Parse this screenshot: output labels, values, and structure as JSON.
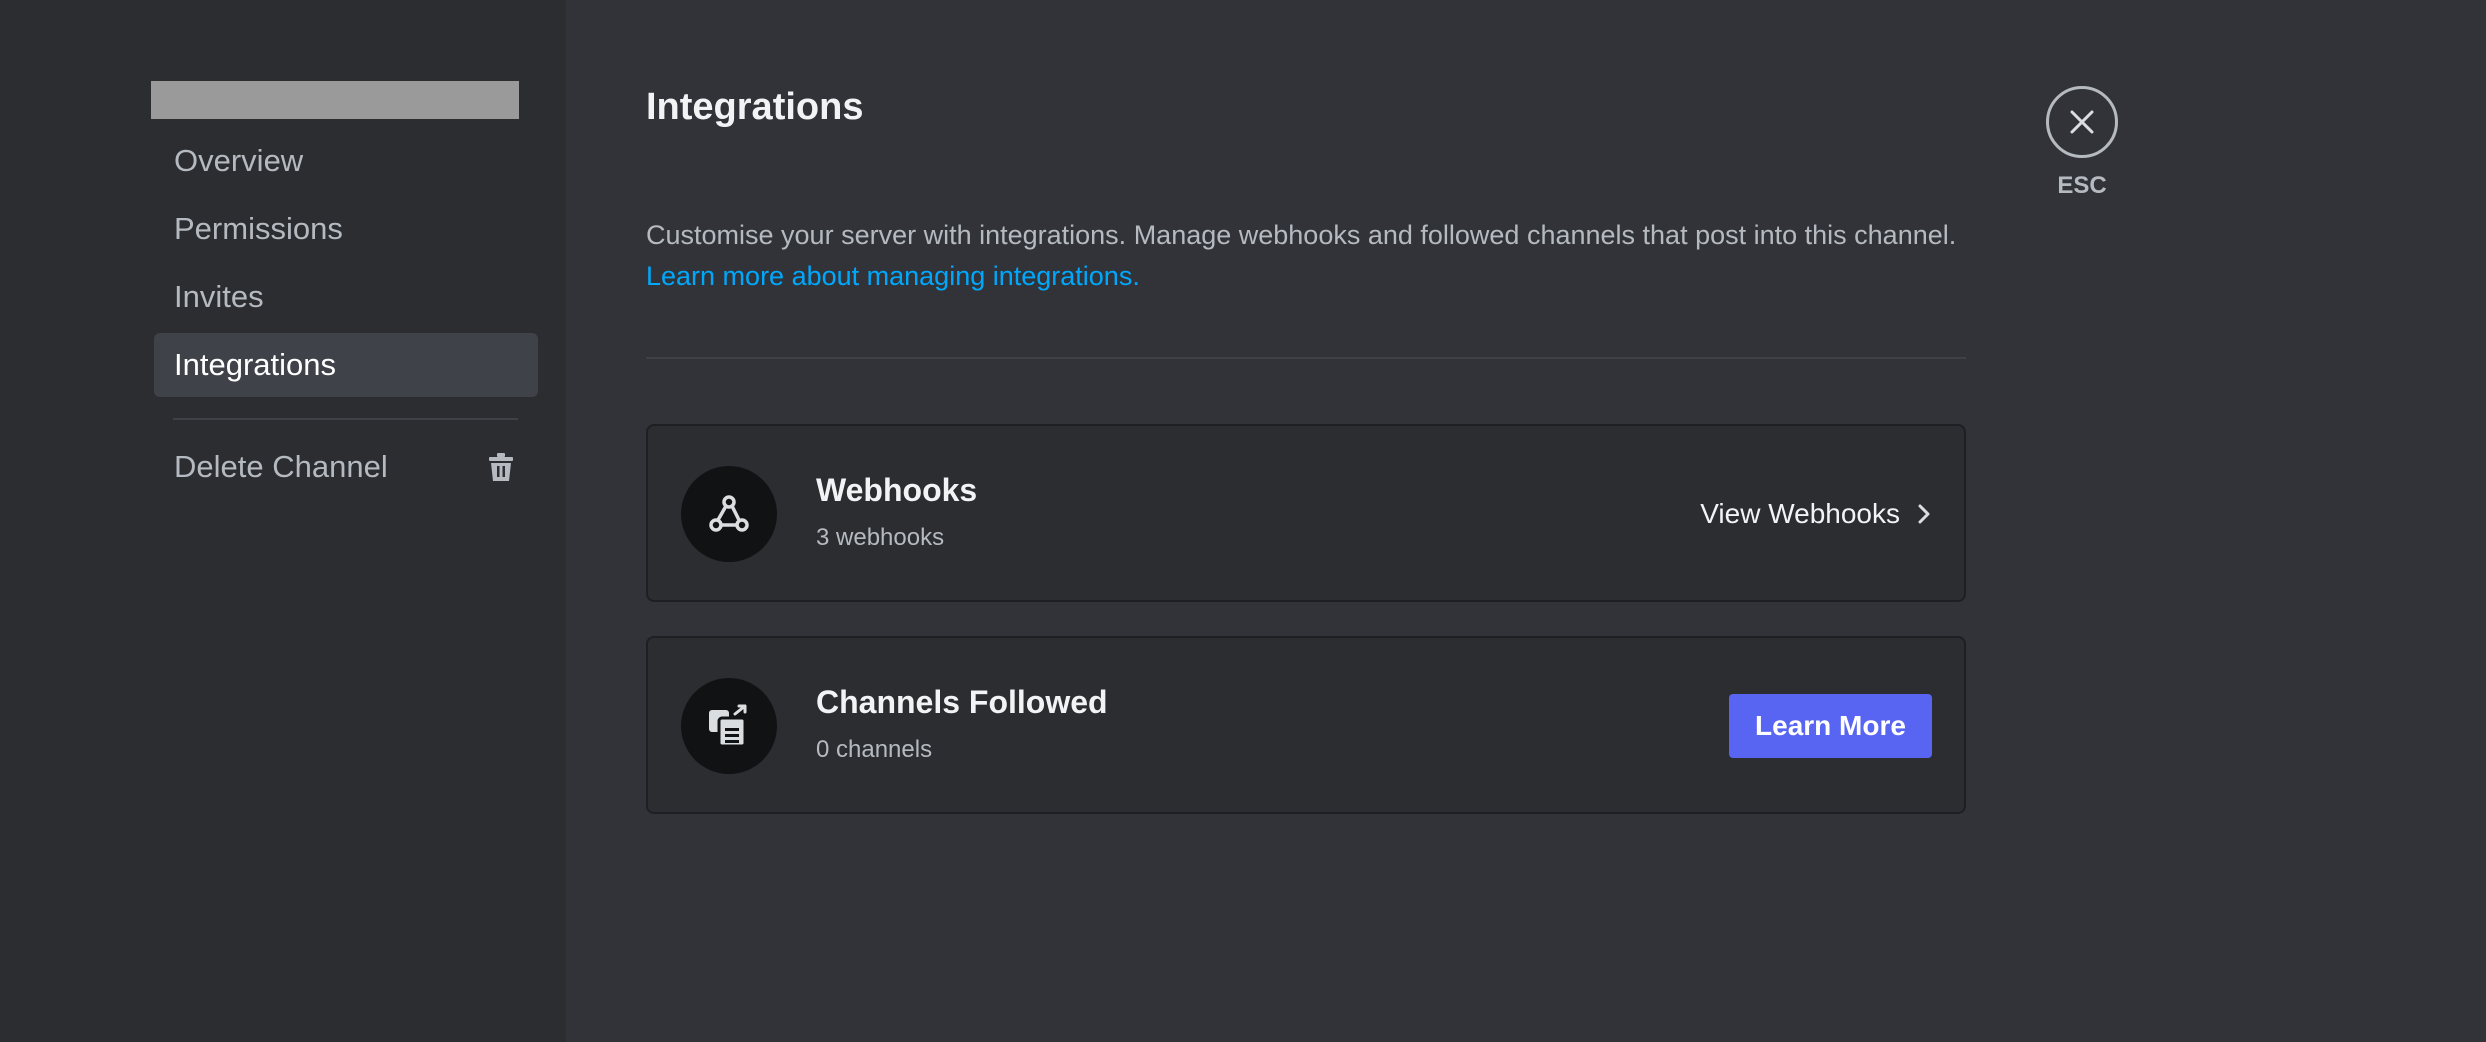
{
  "sidebar": {
    "items": [
      {
        "label": "Overview"
      },
      {
        "label": "Permissions"
      },
      {
        "label": "Invites"
      },
      {
        "label": "Integrations",
        "selected": true
      }
    ],
    "delete_label": "Delete Channel",
    "delete_icon": "trash-icon"
  },
  "main": {
    "title": "Integrations",
    "description": "Customise your server with integrations. Manage webhooks and followed channels that post into this channel.",
    "learn_link": "Learn more about managing integrations.",
    "webhooks": {
      "icon": "webhook-icon",
      "title": "Webhooks",
      "subtitle": "3 webhooks",
      "action_label": "View Webhooks"
    },
    "channels_followed": {
      "icon": "channel-follow-icon",
      "title": "Channels Followed",
      "subtitle": "0 channels",
      "action_label": "Learn More"
    }
  },
  "close": {
    "label": "ESC",
    "icon": "close-icon"
  },
  "colors": {
    "background": "#313338",
    "sidebar": "#2b2d31",
    "accent": "#5865f2",
    "link": "#00a8fc"
  }
}
